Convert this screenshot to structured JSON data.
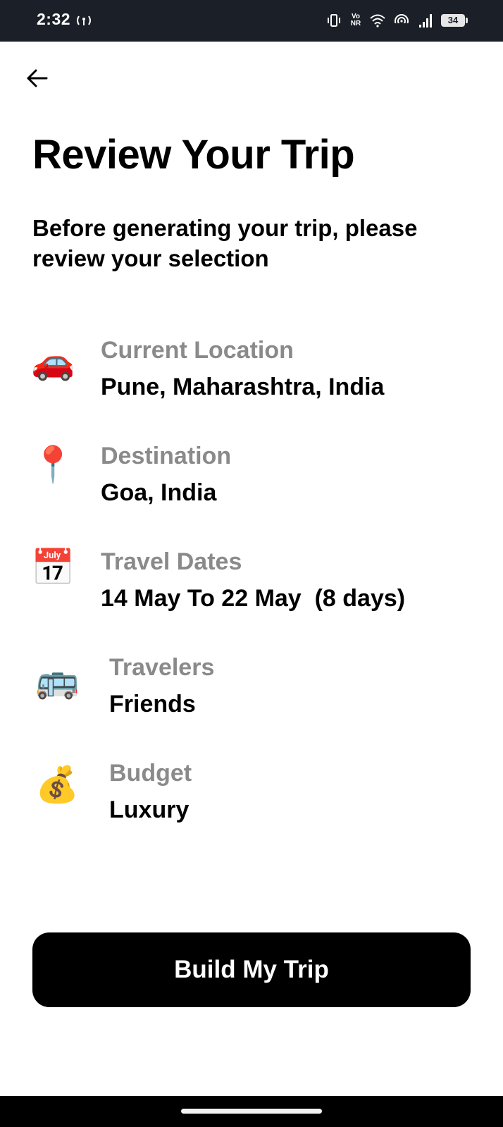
{
  "status_bar": {
    "time": "2:32",
    "volte_top": "Vo",
    "volte_bottom": "NR",
    "battery": "34"
  },
  "header": {
    "title": "Review Your Trip",
    "subtitle": "Before generating your trip, please review your selection"
  },
  "items": [
    {
      "icon": "car-icon",
      "emoji": "🚗",
      "label": "Current Location",
      "value": "Pune, Maharashtra, India"
    },
    {
      "icon": "pin-icon",
      "emoji": "📍",
      "label": "Destination",
      "value": "Goa, India"
    },
    {
      "icon": "calendar-icon",
      "emoji": "📅",
      "label": "Travel Dates",
      "value": "14 May To 22 May  (8 days)"
    },
    {
      "icon": "bus-icon",
      "emoji": "🚌",
      "label": "Travelers",
      "value": "Friends"
    },
    {
      "icon": "money-bag-icon",
      "emoji": "💰",
      "label": "Budget",
      "value": "Luxury"
    }
  ],
  "actions": {
    "build_label": "Build My Trip"
  },
  "colors": {
    "status_bar_bg": "#1b1f27",
    "label_gray": "#8a8a8a",
    "button_bg": "#000000",
    "button_text": "#ffffff"
  }
}
